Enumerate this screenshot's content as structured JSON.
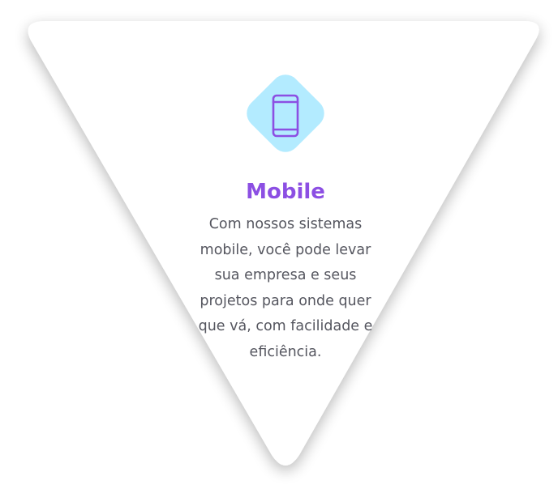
{
  "card": {
    "icon": "smartphone-icon",
    "title": "Mobile",
    "description": "Com nossos sistemas mobile, você pode levar sua empresa e seus projetos para onde quer que vá, com facilidade e eficiência."
  },
  "colors": {
    "accent": "#8c4fe3",
    "badge": "#b3ebff",
    "text": "#55565f",
    "card": "#ffffff"
  }
}
